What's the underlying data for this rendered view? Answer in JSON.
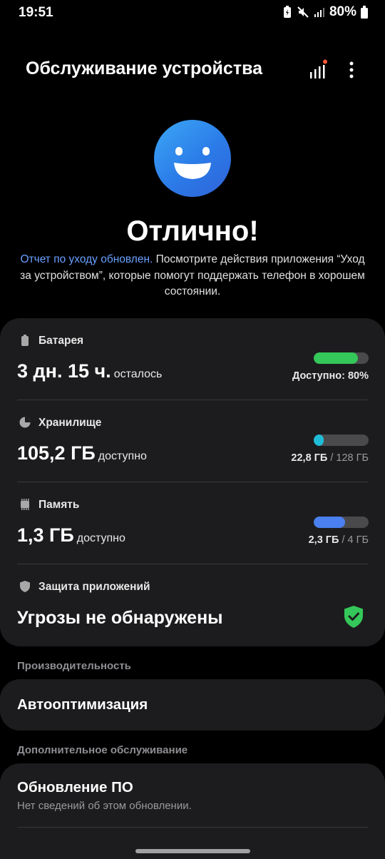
{
  "status_bar": {
    "time": "19:51",
    "battery_pct": "80%",
    "icons": [
      "battery-saver-icon",
      "mute-icon",
      "signal-icon",
      "battery-icon"
    ]
  },
  "header": {
    "title": "Обслуживание устройства",
    "icons": [
      "report-icon",
      "more-options-icon"
    ]
  },
  "status": {
    "title": "Отлично!",
    "link": "Отчет по уходу обновлен.",
    "description": " Посмотрите действия приложения “Уход за устройством”, которые помогут поддержать телефон в хорошем состоянии."
  },
  "battery": {
    "label": "Батарея",
    "value": "3 дн. 15 ч.",
    "suffix": "осталось",
    "caption": "Доступно: 80%",
    "level": 0.8,
    "color": "#34c759"
  },
  "storage": {
    "label": "Хранилище",
    "value": "105,2 ГБ",
    "suffix": "доступно",
    "used": "22,8 ГБ",
    "total": "128 ГБ",
    "level": 0.18,
    "color": "#1fbcd8"
  },
  "memory": {
    "label": "Память",
    "value": "1,3 ГБ",
    "suffix": "доступно",
    "used": "2,3 ГБ",
    "total": "4 ГБ",
    "level": 0.575,
    "color": "#4a80f0"
  },
  "protection": {
    "label": "Защита приложений",
    "value": "Угрозы не обнаружены",
    "color": "#34c759"
  },
  "performance": {
    "section": "Производительность",
    "auto_optimize": "Автооптимизация"
  },
  "additional": {
    "section": "Дополнительное обслуживание",
    "software_update": "Обновление ПО",
    "software_update_sub": "Нет сведений об этом обновлении."
  },
  "separator": " / "
}
